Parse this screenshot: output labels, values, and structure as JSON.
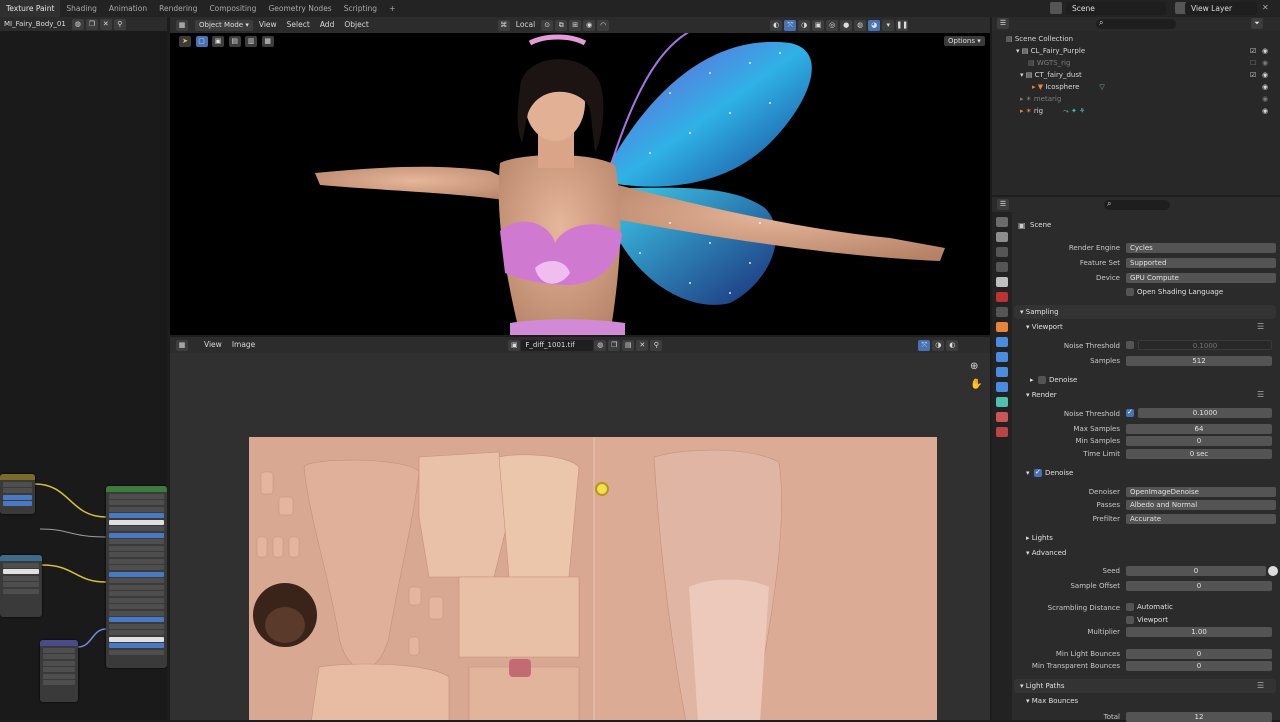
{
  "workspace_tabs": [
    "Texture Paint",
    "Shading",
    "Animation",
    "Rendering",
    "Compositing",
    "Geometry Nodes",
    "Scripting",
    "+"
  ],
  "scene_name": "Scene",
  "view_layer_name": "View Layer",
  "node_editor": {
    "material_name": "MI_Fairy_Body_01"
  },
  "viewport": {
    "mode_label": "Object Mode",
    "menus": [
      "View",
      "Select",
      "Add",
      "Object"
    ],
    "transform_label": "Local",
    "options_label": "Options"
  },
  "image_editor": {
    "menus": [
      "View",
      "Image"
    ],
    "image_name": "F_diff_1001.tif"
  },
  "outliner": {
    "rows": [
      {
        "label": "Scene Collection",
        "dim": false
      },
      {
        "label": "CL_Fairy_Purple",
        "dim": false
      },
      {
        "label": "WGTS_rig",
        "dim": true
      },
      {
        "label": "CT_fairy_dust",
        "dim": false
      },
      {
        "label": "Icosphere",
        "dim": false
      },
      {
        "label": "metarig",
        "dim": true
      },
      {
        "label": "rig",
        "dim": false
      }
    ]
  },
  "properties": {
    "context": "Scene",
    "render_engine_label": "Render Engine",
    "render_engine": "Cycles",
    "feature_set_label": "Feature Set",
    "feature_set": "Supported",
    "device_label": "Device",
    "device": "GPU Compute",
    "osl_label": "Open Shading Language",
    "sampling": "Sampling",
    "viewport": "Viewport",
    "vp_noise_label": "Noise Threshold",
    "vp_noise": "0.1000",
    "vp_samples_label": "Samples",
    "vp_samples": "512",
    "vp_denoise": "Denoise",
    "render": "Render",
    "r_noise_label": "Noise Threshold",
    "r_noise": "0.1000",
    "max_samples_label": "Max Samples",
    "max_samples": "64",
    "min_samples_label": "Min Samples",
    "min_samples": "0",
    "time_limit_label": "Time Limit",
    "time_limit": "0 sec",
    "denoise": "Denoise",
    "denoiser_label": "Denoiser",
    "denoiser": "OpenImageDenoise",
    "passes_label": "Passes",
    "passes": "Albedo and Normal",
    "prefilter_label": "Prefilter",
    "prefilter": "Accurate",
    "lights": "Lights",
    "advanced": "Advanced",
    "seed_label": "Seed",
    "seed": "0",
    "sample_offset_label": "Sample Offset",
    "sample_offset": "0",
    "scrambling_label": "Scrambling Distance",
    "automatic": "Automatic",
    "sd_viewport": "Viewport",
    "multiplier_label": "Multiplier",
    "multiplier": "1.00",
    "min_light_bounces_label": "Min Light Bounces",
    "min_light_bounces": "0",
    "min_transparent_bounces_label": "Min Transparent Bounces",
    "min_transparent_bounces": "0",
    "light_paths": "Light Paths",
    "max_bounces": "Max Bounces",
    "total_label": "Total",
    "total": "12"
  }
}
